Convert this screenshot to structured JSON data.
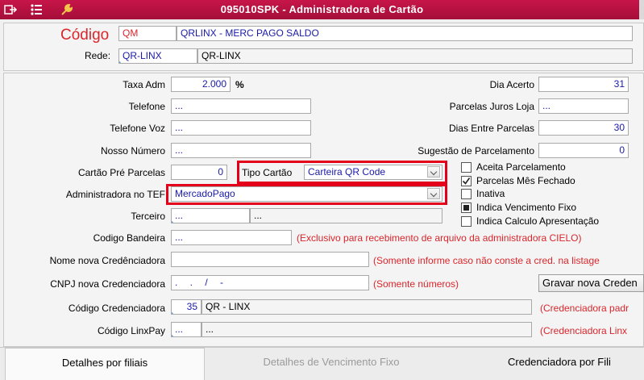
{
  "window": {
    "title": "095010SPK - Administradora de Cartão"
  },
  "header": {
    "codigo_label": "Código",
    "codigo_value": "QM",
    "codigo_desc": "QRLINX - MERC PAGO SALDO",
    "rede_label": "Rede:",
    "rede_value": "QR-LINX",
    "rede_desc": "QR-LINX"
  },
  "form": {
    "taxa_adm_label": "Taxa Adm",
    "taxa_adm_value": "2.000",
    "taxa_adm_unit": "%",
    "telefone_label": "Telefone",
    "telefone_value": "...",
    "telefone_voz_label": "Telefone Voz",
    "telefone_voz_value": "...",
    "nosso_numero_label": "Nosso Número",
    "nosso_numero_value": "...",
    "cartao_pre_label": "Cartão Pré Parcelas",
    "cartao_pre_value": "0",
    "tipo_cartao_label": "Tipo Cartão",
    "tipo_cartao_value": "Carteira QR Code",
    "administradora_tef_label": "Administradora no TEF",
    "administradora_tef_value": "MercadoPago",
    "terceiro_label": "Terceiro",
    "terceiro_value": "...",
    "terceiro_desc": "...",
    "codigo_bandeira_label": "Codigo Bandeira",
    "codigo_bandeira_value": "...",
    "codigo_bandeira_note": "(Exclusivo para recebimento de arquivo da administradora CIELO)",
    "nome_cred_label": "Nome nova Credênciadora",
    "nome_cred_value": "",
    "nome_cred_note": "(Somente informe caso não conste a cred. na listage",
    "cnpj_cred_label": "CNPJ nova Credenciadora",
    "cnpj_cred_value": ". . / -",
    "cnpj_cred_note": "(Somente números)",
    "gravar_button": "Gravar nova Creden",
    "codigo_cred_label": "Código Credenciadora",
    "codigo_cred_value": "35",
    "codigo_cred_desc": "QR - LINX",
    "codigo_cred_note": "(Credenciadora padr",
    "codigo_linxpay_label": "Código LinxPay",
    "codigo_linxpay_value": "...",
    "codigo_linxpay_desc": "...",
    "codigo_linxpay_note": "(Credenciadora Linx"
  },
  "right": {
    "dia_acerto_label": "Dia Acerto",
    "dia_acerto_value": "31",
    "parcelas_juros_label": "Parcelas Juros Loja",
    "parcelas_juros_value": "...",
    "dias_entre_label": "Dias Entre Parcelas",
    "dias_entre_value": "30",
    "sugestao_label": "Sugestão de Parcelamento",
    "sugestao_value": "0"
  },
  "checkboxes": [
    {
      "label": "Aceita Parcelamento",
      "state": "unchecked"
    },
    {
      "label": "Parcelas Mês Fechado",
      "state": "checked"
    },
    {
      "label": "Inativa",
      "state": "unchecked"
    },
    {
      "label": "Indica Vencimento Fixo",
      "state": "filled"
    },
    {
      "label": "Indica Calculo Apresentação",
      "state": "unchecked"
    }
  ],
  "tabs": [
    {
      "label": "Detalhes por filiais",
      "active": true
    },
    {
      "label": "Detalhes de Vencimento Fixo",
      "active": false
    },
    {
      "label": "Credenciadora por Fili",
      "active": false
    }
  ],
  "colors": {
    "titlebar": "#b8123f",
    "accent_red": "#e4001b",
    "value_blue": "#1a1aa6",
    "note_red": "#d9262c"
  }
}
